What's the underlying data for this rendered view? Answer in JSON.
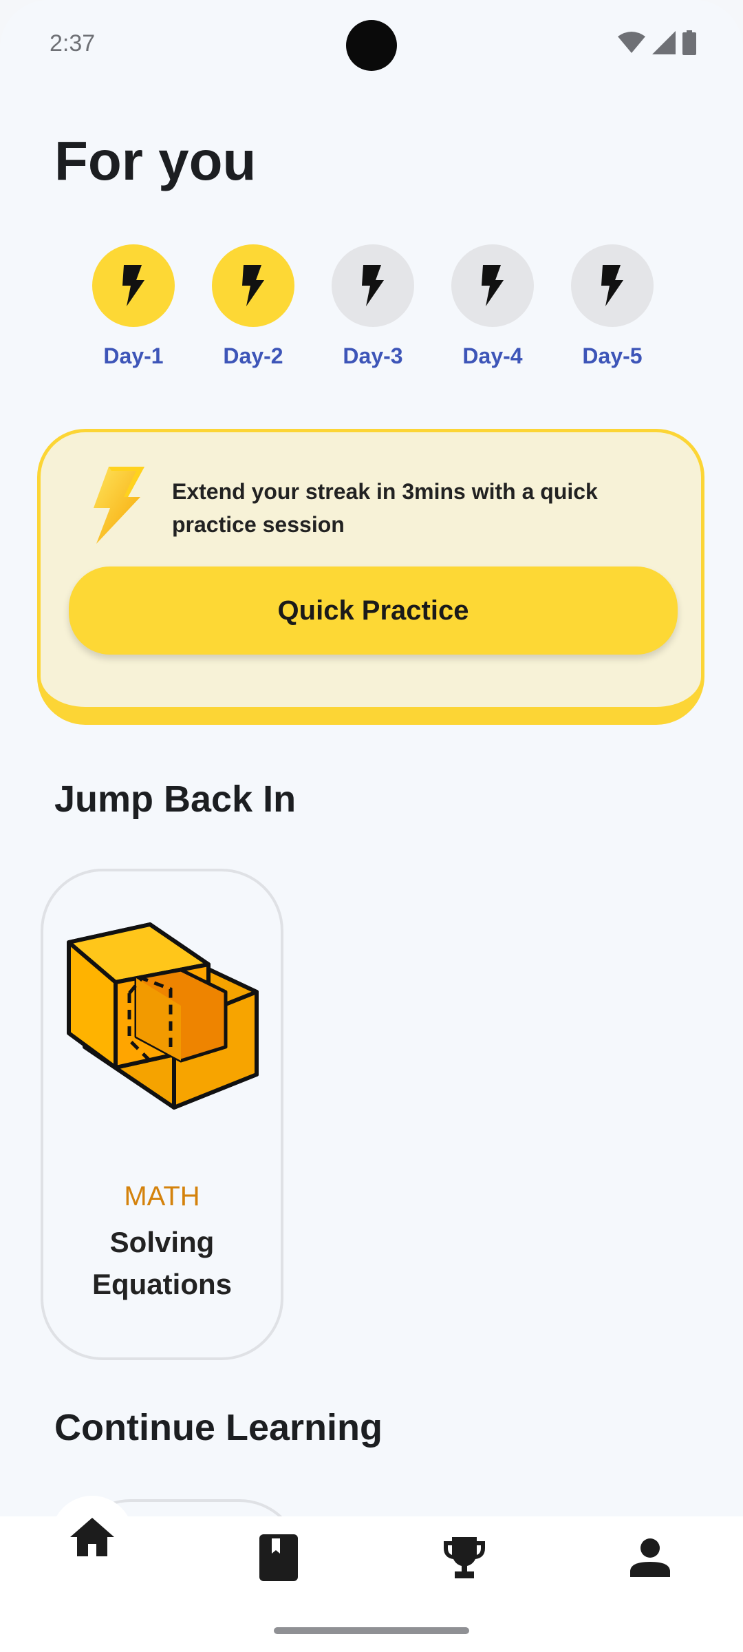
{
  "status_bar": {
    "time": "2:37",
    "icons": [
      "wifi-icon",
      "signal-icon",
      "battery-icon"
    ]
  },
  "page_title": "For you",
  "streak": {
    "days": [
      {
        "label": "Day-1",
        "completed": true
      },
      {
        "label": "Day-2",
        "completed": true
      },
      {
        "label": "Day-3",
        "completed": false
      },
      {
        "label": "Day-4",
        "completed": false
      },
      {
        "label": "Day-5",
        "completed": false
      }
    ],
    "message": "Extend your streak in 3mins with a quick practice session",
    "button_label": "Quick Practice"
  },
  "jump_back_in": {
    "title": "Jump Back In",
    "course": {
      "subject": "MATH",
      "name": "Solving Equations",
      "icon": "cube-icon"
    }
  },
  "continue_learning": {
    "title": "Continue Learning"
  },
  "bottom_nav": {
    "items": [
      {
        "icon": "home-icon",
        "active": true
      },
      {
        "icon": "book-icon",
        "active": false
      },
      {
        "icon": "trophy-icon",
        "active": false
      },
      {
        "icon": "profile-icon",
        "active": false
      }
    ]
  },
  "colors": {
    "accent_yellow": "#fdd835",
    "day_label_blue": "#3d55b8",
    "subject_orange": "#d4820c",
    "inactive_circle": "#e4e5e8"
  }
}
